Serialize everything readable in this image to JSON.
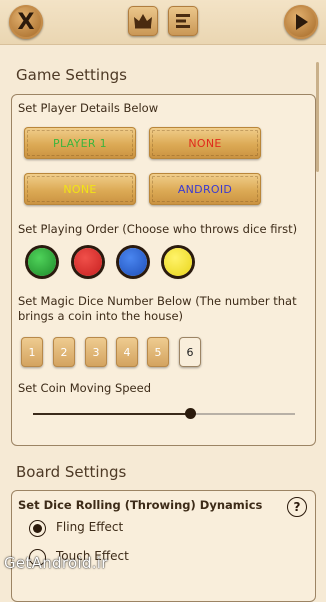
{
  "toolbar": {
    "close_label": "X",
    "crown_icon": "crown-icon",
    "menu_icon": "list-icon",
    "play_icon": "play-icon"
  },
  "game_settings": {
    "title": "Game Settings",
    "player_details_label": "Set Player Details Below",
    "players": [
      {
        "label": "PLAYER 1",
        "color": "#3db53d"
      },
      {
        "label": "NONE",
        "color": "#e02b1c"
      },
      {
        "label": "NONE",
        "color": "#f2e415"
      },
      {
        "label": "ANDROID",
        "color": "#3b3bd1"
      }
    ],
    "order_label": "Set Playing Order (Choose who throws dice first)",
    "order_colors": [
      "#1f8a2a",
      "#c71f1f",
      "#1f4fb8",
      "#e9d51a"
    ],
    "magic_dice_label": "Set Magic Dice Number Below (The number that brings a coin into the house)",
    "dice_numbers": [
      "1",
      "2",
      "3",
      "4",
      "5",
      "6"
    ],
    "dice_selected": "6",
    "speed_label": "Set Coin Moving Speed",
    "speed_value": 0.6
  },
  "board_settings": {
    "title": "Board Settings",
    "dynamics_label": "Set Dice Rolling (Throwing) Dynamics",
    "help_label": "?",
    "options": [
      {
        "label": "Fling Effect",
        "selected": true
      },
      {
        "label": "Touch Effect",
        "selected": false
      }
    ]
  },
  "watermark": "GetAndroid.ir"
}
